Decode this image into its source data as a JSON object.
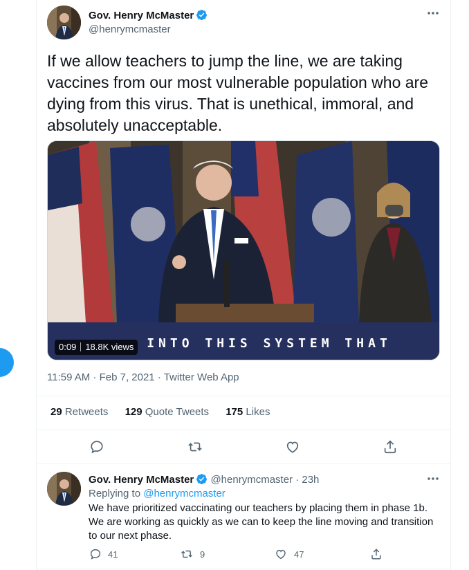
{
  "tweet": {
    "author_name": "Gov. Henry McMaster",
    "handle": "@henrymcmaster",
    "text": "If we allow teachers to jump the line, we are taking vaccines from our most vulnerable population who are dying from this virus. That is unethical, immoral, and absolutely unacceptable.",
    "video": {
      "caption": "INTO THIS SYSTEM THAT",
      "time": "0:09",
      "views": "18.8K views"
    },
    "timestamp": "11:59 AM · Feb 7, 2021 · Twitter Web App",
    "stats": {
      "retweets_count": "29",
      "retweets_label": "Retweets",
      "quotes_count": "129",
      "quotes_label": "Quote Tweets",
      "likes_count": "175",
      "likes_label": "Likes"
    }
  },
  "reply": {
    "author_name": "Gov. Henry McMaster",
    "handle_time": "@henrymcmaster · 23h",
    "replying_prefix": "Replying to",
    "replying_handle": "@henrymcmaster",
    "text": "We have prioritized vaccinating our teachers by placing them in phase 1b. We are working as quickly as we can to keep the line moving and transition to our next phase.",
    "reply_count": "41",
    "retweet_count": "9",
    "like_count": "47"
  },
  "icons": [
    "verified-icon",
    "more-icon",
    "reply-icon",
    "retweet-icon",
    "like-icon",
    "share-icon"
  ],
  "colors": {
    "accent": "#1d9bf0",
    "secondary_text": "#536471",
    "caption_band": "#26305e"
  }
}
